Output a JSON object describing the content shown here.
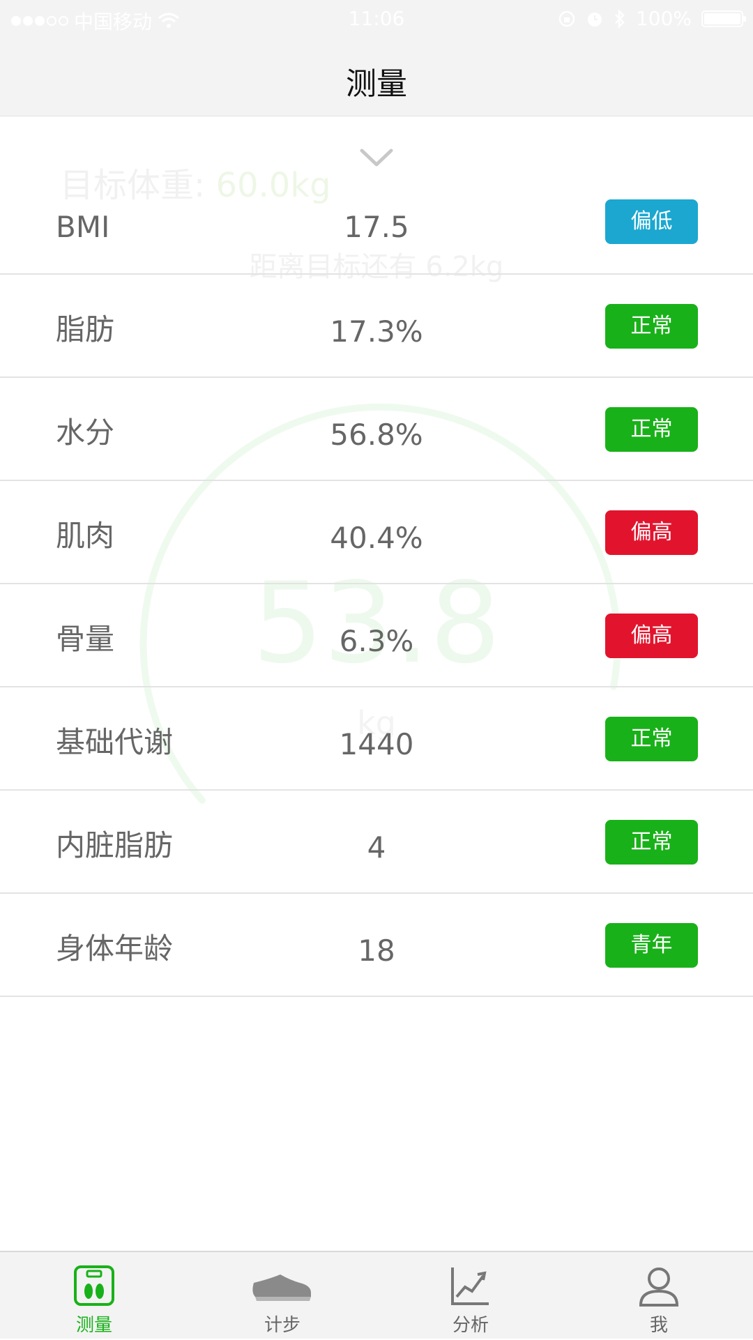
{
  "status_bar": {
    "carrier": "中国移动",
    "time": "11:06",
    "battery": "100%"
  },
  "nav": {
    "title": "测量"
  },
  "background": {
    "target_label": "目标体重:",
    "target_value": "60.0kg",
    "distance_text": "距离目标还有 6.2kg",
    "weight": "53.8",
    "unit": "kg"
  },
  "colors": {
    "low": "#1ba7d0",
    "normal": "#19b119",
    "high": "#e2142d",
    "accent": "#19b119"
  },
  "metrics": [
    {
      "label": "BMI",
      "value": "17.5",
      "status": "偏低",
      "status_color": "#1ba7d0"
    },
    {
      "label": "脂肪",
      "value": "17.3%",
      "status": "正常",
      "status_color": "#19b119"
    },
    {
      "label": "水分",
      "value": "56.8%",
      "status": "正常",
      "status_color": "#19b119"
    },
    {
      "label": "肌肉",
      "value": "40.4%",
      "status": "偏高",
      "status_color": "#e2142d"
    },
    {
      "label": "骨量",
      "value": "6.3%",
      "status": "偏高",
      "status_color": "#e2142d"
    },
    {
      "label": "基础代谢",
      "value": "1440",
      "status": "正常",
      "status_color": "#19b119"
    },
    {
      "label": "内脏脂肪",
      "value": "4",
      "status": "正常",
      "status_color": "#19b119"
    },
    {
      "label": "身体年龄",
      "value": "18",
      "status": "青年",
      "status_color": "#19b119"
    }
  ],
  "tabs": [
    {
      "label": "测量",
      "icon": "scale-icon",
      "active": true
    },
    {
      "label": "计步",
      "icon": "shoe-icon",
      "active": false
    },
    {
      "label": "分析",
      "icon": "chart-icon",
      "active": false
    },
    {
      "label": "我",
      "icon": "person-icon",
      "active": false
    }
  ]
}
